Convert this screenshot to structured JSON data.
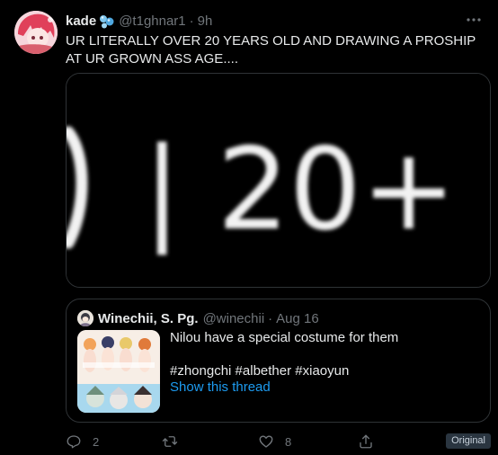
{
  "tweet": {
    "author_name": "kade",
    "author_emoji": "blue-bubbles-emoji",
    "handle": "@t1ghnar1",
    "separator": "·",
    "time": "9h",
    "more_icon": "more-icon",
    "text": "UR LITERALLY OVER 20 YEARS OLD AND DRAWING A PROSHIP AT UR GROWN ASS AGE....",
    "media_text": "| 20+"
  },
  "quote": {
    "author_name": "Winechii, S. Pg.",
    "handle": "@winechii",
    "separator": "·",
    "time": "Aug 16",
    "line1": "Nilou have a special costume for them",
    "hashtags": "#zhongchi #albether #xiaoyun",
    "show_thread": "Show this thread"
  },
  "actions": {
    "reply_count": "2",
    "retweet_count": "",
    "like_count": "8",
    "icons": [
      "reply-icon",
      "retweet-icon",
      "like-icon",
      "share-icon"
    ]
  },
  "badge": {
    "label": "Original"
  },
  "colors": {
    "background": "#000000",
    "text": "#e7e9ea",
    "muted": "#71767b",
    "link": "#1d9bf0",
    "border": "#2f3336"
  }
}
